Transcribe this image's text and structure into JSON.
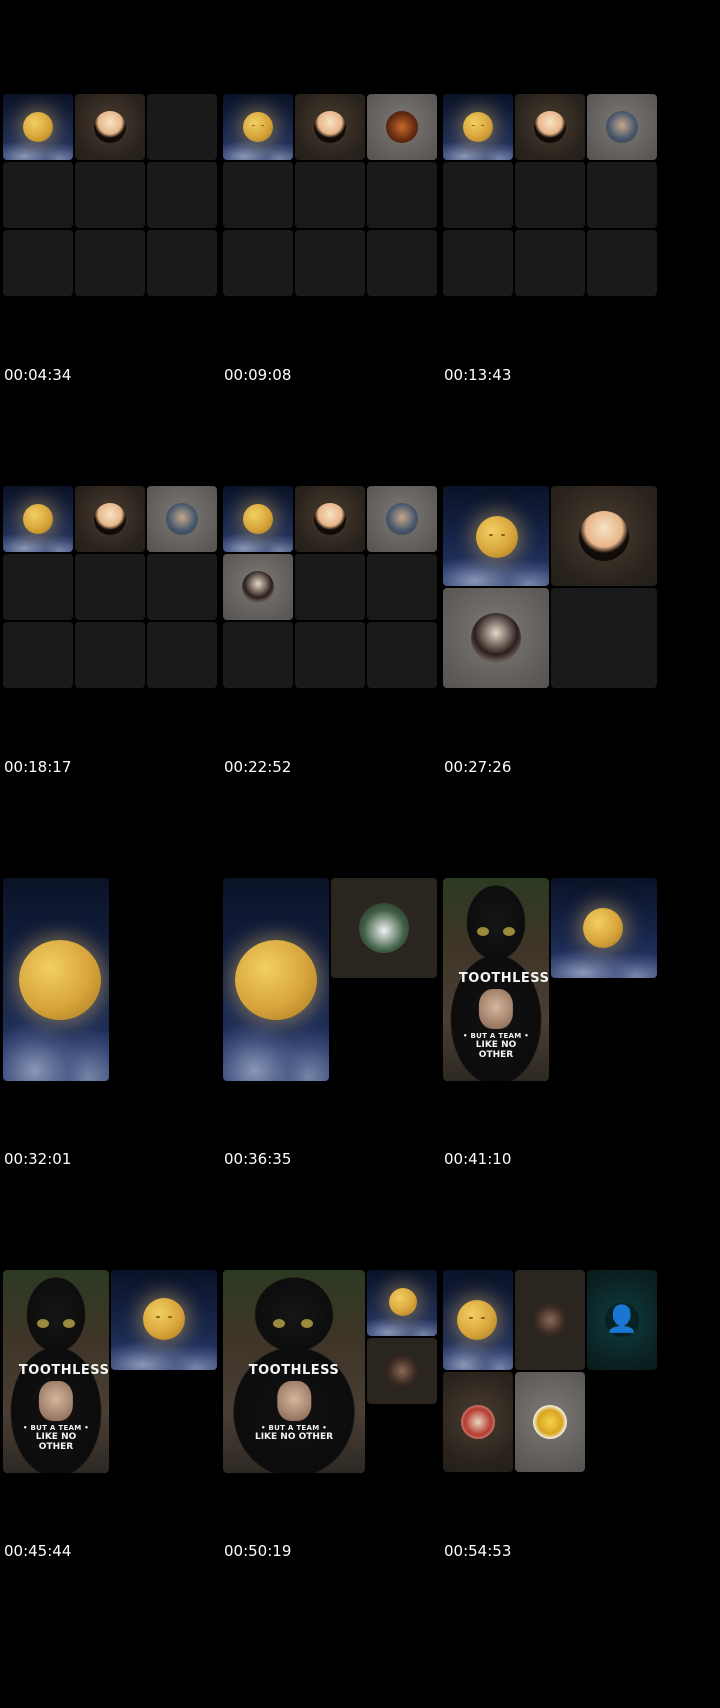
{
  "timestamps": [
    "00:04:34",
    "00:09:08",
    "00:13:43",
    "00:18:17",
    "00:22:52",
    "00:27:26",
    "00:32:01",
    "00:36:35",
    "00:41:10",
    "00:45:44",
    "00:50:19",
    "00:54:53"
  ],
  "shirt_text": {
    "title": "TOOTHLESS",
    "line1": "• BUT A TEAM •",
    "line2": "LIKE NO OTHER"
  },
  "icons": {
    "amongus": "👤"
  }
}
